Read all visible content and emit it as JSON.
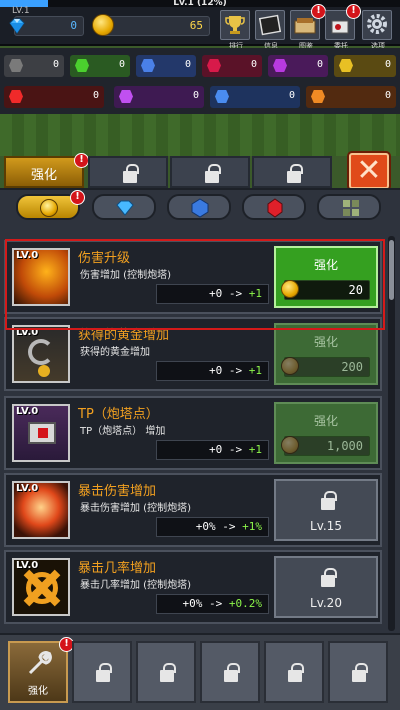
{
  "top": {
    "level_label": "LV.1",
    "xp_label": "Lv.1 (12%)",
    "xp_fraction": 0.12,
    "gems": "0",
    "coins": "65",
    "buttons": [
      {
        "label": "排行",
        "icon": "trophy-icon",
        "badge": ""
      },
      {
        "label": "信息",
        "icon": "info-icon",
        "badge": ""
      },
      {
        "label": "图鉴",
        "icon": "book-icon",
        "badge": "!"
      },
      {
        "label": "委托",
        "icon": "quest-icon",
        "badge": "!"
      },
      {
        "label": "选项",
        "icon": "gear-icon",
        "badge": ""
      }
    ]
  },
  "resources": {
    "row1": [
      {
        "color": "#6b6b6b",
        "value": "0"
      },
      {
        "color": "#3fae2a",
        "value": "0"
      },
      {
        "color": "#3f6fd6",
        "value": "0"
      },
      {
        "color": "#c0143c",
        "value": "0"
      },
      {
        "color": "#a030c8",
        "value": "0"
      },
      {
        "color": "#d8b020",
        "value": "0"
      }
    ],
    "row2": [
      {
        "color": "#e02020",
        "value": "0"
      },
      {
        "color": "#b040e0",
        "value": "0"
      },
      {
        "color": "#3a7ae0",
        "value": "0"
      },
      {
        "color": "#e07a20",
        "value": "0"
      }
    ]
  },
  "tabs": {
    "active_label": "强化",
    "active_badge": "!",
    "close_label": "✕"
  },
  "subtabs": [
    "coin",
    "diamond",
    "blue-gem",
    "red-gem",
    "block"
  ],
  "upgrades": [
    {
      "level": "LV.0",
      "title": "伤害升级",
      "desc": "伤害增加 (控制炮塔)",
      "current": "+0",
      "arrow": " -> ",
      "next": "+1",
      "button": "强化",
      "cost": "20",
      "state": "active"
    },
    {
      "level": "LV.0",
      "title": "获得的黄金增加",
      "desc": "获得的黄金增加",
      "current": "+0",
      "arrow": " -> ",
      "next": "+1",
      "button": "强化",
      "cost": "200",
      "state": "dim"
    },
    {
      "level": "LV.0",
      "title": "TP（炮塔点）",
      "desc": "TP（炮塔点） 增加",
      "current": "+0",
      "arrow": " -> ",
      "next": "+1",
      "button": "强化",
      "cost": "1,000",
      "state": "dim"
    },
    {
      "level": "LV.0",
      "title": "暴击伤害增加",
      "desc": "暴击伤害增加 (控制炮塔)",
      "current": "+0%",
      "arrow": " -> ",
      "next": "+1%",
      "unlock": "Lv.15",
      "state": "locked"
    },
    {
      "level": "LV.0",
      "title": "暴击几率增加",
      "desc": "暴击几率增加 (控制炮塔)",
      "current": "+0%",
      "arrow": " -> ",
      "next": "+0.2%",
      "unlock": "Lv.20",
      "state": "locked"
    }
  ],
  "bottom": {
    "active_label": "强化",
    "active_badge": "!"
  }
}
